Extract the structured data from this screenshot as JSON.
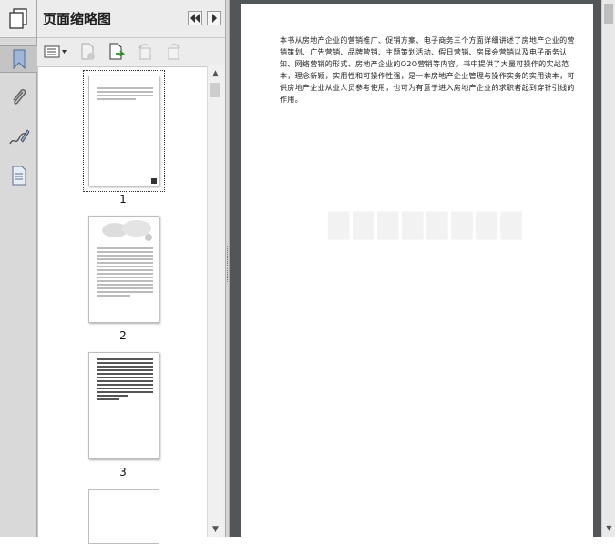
{
  "panel": {
    "title": "页面缩略图",
    "collapse_icon": "double-left-arrow-icon",
    "expand_icon": "right-arrow-icon"
  },
  "rail": {
    "items": [
      "pages-icon",
      "bookmark-icon",
      "paperclip-icon",
      "signature-icon",
      "document-icon"
    ]
  },
  "toolbar": {
    "buttons": [
      "options-menu-icon",
      "delete-page-icon",
      "insert-page-icon",
      "rotate-left-icon",
      "rotate-right-icon"
    ]
  },
  "thumbnails": [
    {
      "label": "1",
      "selected": true
    },
    {
      "label": "2",
      "selected": false
    },
    {
      "label": "3",
      "selected": false
    }
  ],
  "document": {
    "paragraph": "本书从房地产企业的营销推广、促销方案、电子商务三个方面详细讲述了房地产企业的营销策划、广告营销、品牌营销、主题策划活动、假日营销、房展会营销以及电子商务认知、网络营销的形式、房地产企业的O2O营销等内容。书中提供了大量可操作的实战范本，理念新颖，实用性和可操作性强，是一本房地产企业管理与操作实务的实用读本，可供房地产企业从业人员参考使用，也可为有意于进入房地产企业的求职者起到穿针引线的作用。"
  },
  "colors": {
    "doc_background": "#525659",
    "panel_background": "#efefef",
    "rail_background": "#d9d9d9"
  }
}
